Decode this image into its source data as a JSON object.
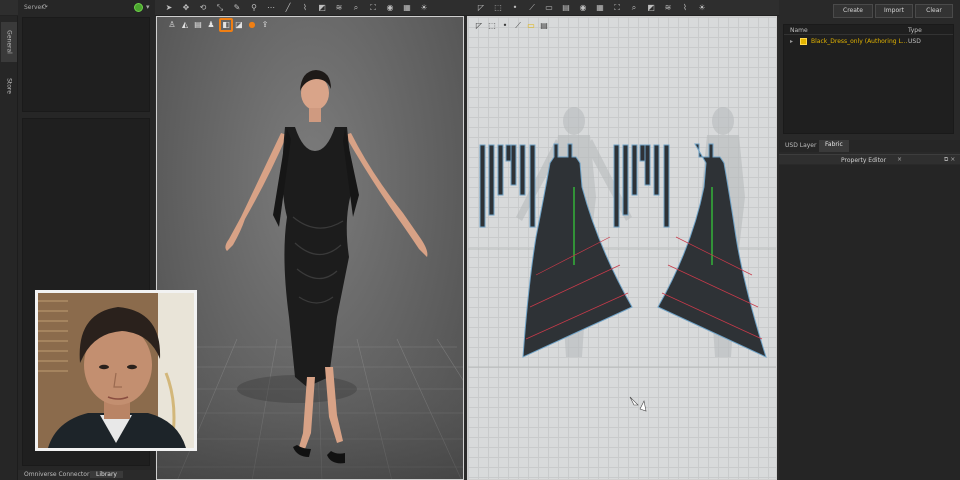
{
  "left_tabs": [
    "General",
    "Store"
  ],
  "left_panel": {
    "header_title": "Server",
    "bottom_tabs": [
      "Omniverse Connector",
      "Library"
    ]
  },
  "toolbar": {
    "icons": [
      "pointer-icon",
      "move-icon",
      "rotate-icon",
      "scale-icon",
      "brush-icon",
      "pin-icon",
      "seam-icon",
      "needle-icon",
      "sew-icon",
      "fold-icon",
      "pleat-icon",
      "zoom-icon",
      "fit-icon",
      "camera-icon",
      "grid-icon",
      "render-icon"
    ]
  },
  "viewport3d": {
    "tools": [
      "avatar-icon",
      "garment-icon",
      "texture-icon",
      "arrangement-icon",
      "fabric-icon",
      "pattern-icon",
      "material-icon",
      "export-icon"
    ],
    "active_tool_index": 4
  },
  "viewport2d": {
    "tools": [
      "select-icon",
      "transform-icon",
      "point-icon",
      "segment-icon",
      "pattern-tool-icon",
      "texture-icon"
    ]
  },
  "right_panel": {
    "buttons": [
      "Create",
      "Import",
      "Clear"
    ],
    "scene_tree": {
      "columns": [
        "Name",
        "Type"
      ],
      "rows": [
        {
          "name": "Black_Dress_only (Authoring L...",
          "type": "USD"
        }
      ]
    },
    "tabs": [
      "USD Layer",
      "Fabric"
    ],
    "active_tab": "Fabric",
    "property_editor_title": "Property Editor"
  },
  "colors": {
    "accent_orange": "#f07f13",
    "usd_yellow": "#e3b400",
    "status_green": "#4aa52e",
    "pattern_fill": "#2e3236",
    "pattern_outline": "#6fa2c6",
    "grain_line": "#35d23a",
    "internal_line": "#c83a4a"
  }
}
